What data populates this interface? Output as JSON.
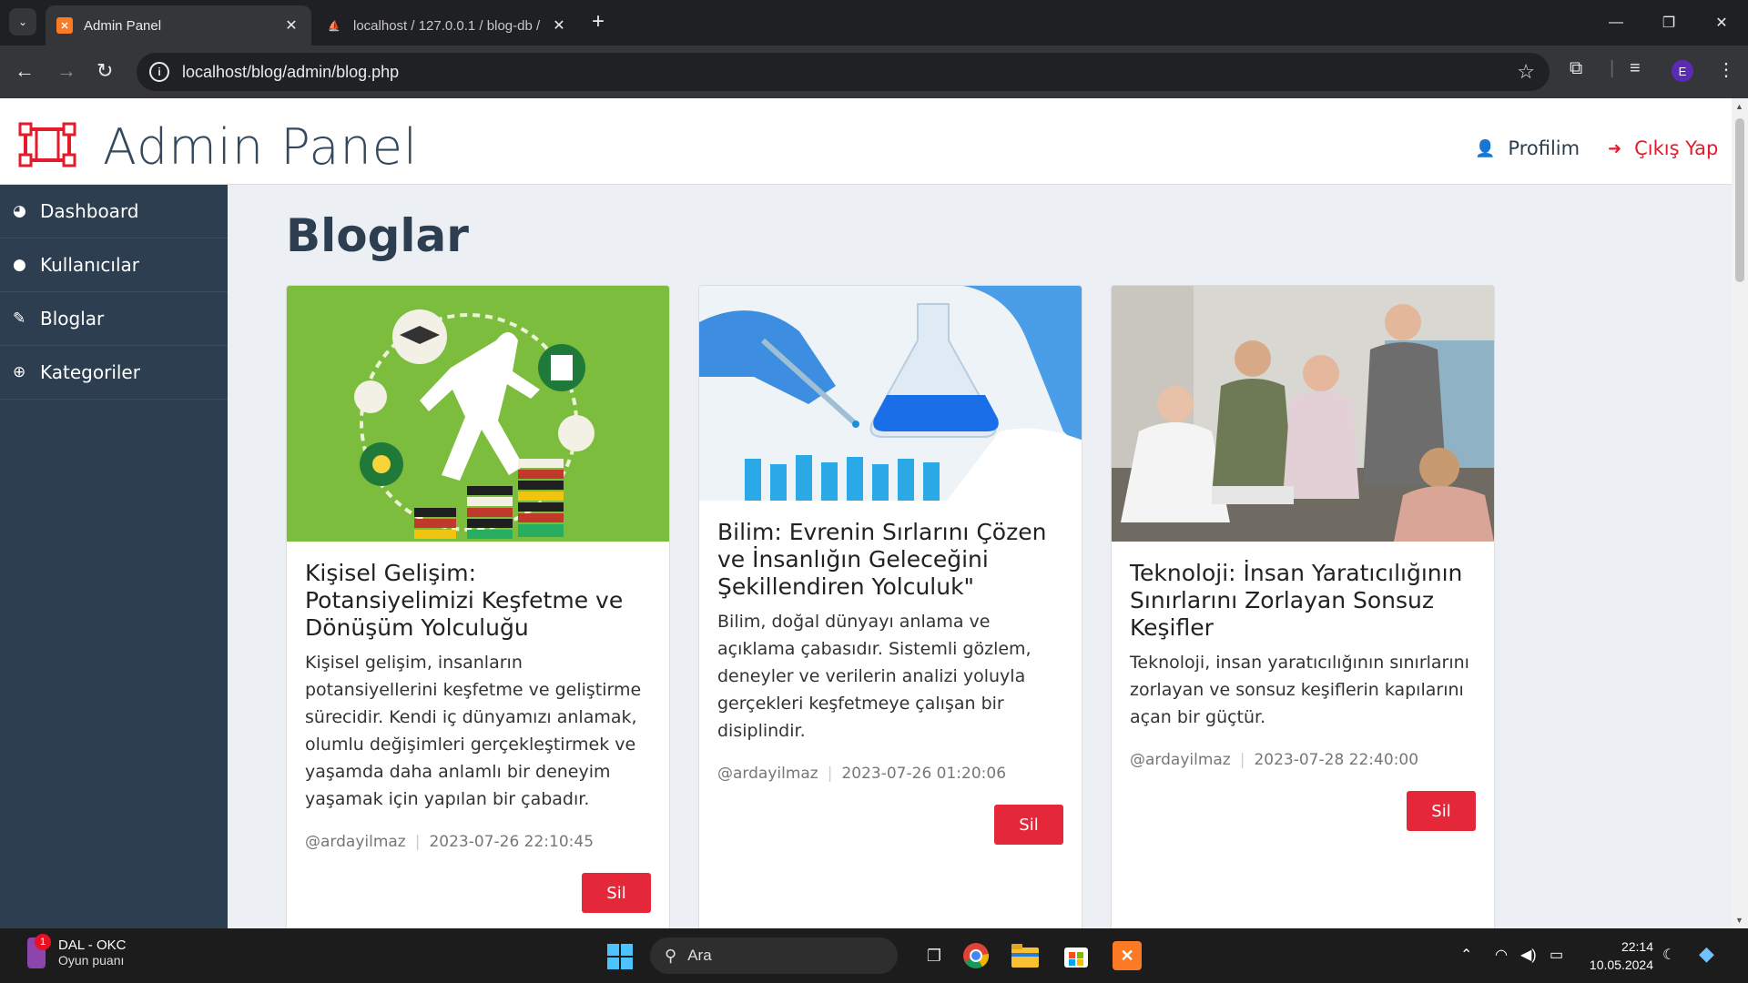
{
  "browser": {
    "tabs": [
      {
        "title": "Admin Panel",
        "active": true
      },
      {
        "title": "localhost / 127.0.0.1 / blog-db /",
        "active": false
      }
    ],
    "url": "localhost/blog/admin/blog.php",
    "profile_initial": "E"
  },
  "header": {
    "brand": "Admin Panel",
    "profile_label": "Profilim",
    "logout_label": "Çıkış Yap"
  },
  "sidebar": {
    "items": [
      {
        "label": "Dashboard",
        "icon": "dashboard-icon"
      },
      {
        "label": "Kullanıcılar",
        "icon": "user-icon"
      },
      {
        "label": "Bloglar",
        "icon": "pencil-icon"
      },
      {
        "label": "Kategoriler",
        "icon": "plus-circle-icon"
      }
    ]
  },
  "main": {
    "title": "Bloglar",
    "posts": [
      {
        "title": "Kişisel Gelişim: Potansiyelimizi Keşfetme ve Dönüşüm Yolculuğu",
        "excerpt": "Kişisel gelişim, insanların potansiyellerini keşfetme ve geliştirme sürecidir. Kendi iç dünyamızı anlamak, olumlu değişimleri gerçekleştirmek ve yaşamda daha anlamlı bir deneyim yaşamak için yapılan bir çabadır.",
        "author": "@ardayilmaz",
        "date": "2023-07-26 22:10:45",
        "delete_label": "Sil"
      },
      {
        "title": "Bilim: Evrenin Sırlarını Çözen ve İnsanlığın Geleceğini Şekillendiren Yolculuk\"",
        "excerpt": "Bilim, doğal dünyayı anlama ve açıklama çabasıdır. Sistemli gözlem, deneyler ve verilerin analizi yoluyla gerçekleri keşfetmeye çalışan bir disiplindir.",
        "author": "@ardayilmaz",
        "date": "2023-07-26 01:20:06",
        "delete_label": "Sil"
      },
      {
        "title": "Teknoloji: İnsan Yaratıcılığının Sınırlarını Zorlayan Sonsuz Keşifler",
        "excerpt": "Teknoloji, insan yaratıcılığının sınırlarını zorlayan ve sonsuz keşiflerin kapılarını açan bir güçtür.",
        "author": "@ardayilmaz",
        "date": "2023-07-28 22:40:00",
        "delete_label": "Sil"
      }
    ]
  },
  "taskbar": {
    "weather_title": "DAL - OKC",
    "weather_sub": "Oyun puanı",
    "notification_count": "1",
    "search_placeholder": "Ara",
    "time": "22:14",
    "date": "10.05.2024"
  },
  "colors": {
    "sidebar_bg": "#2c3e50",
    "danger": "#e4283a",
    "page_bg": "#ecf0f5",
    "logout_red": "#e41b2b"
  }
}
